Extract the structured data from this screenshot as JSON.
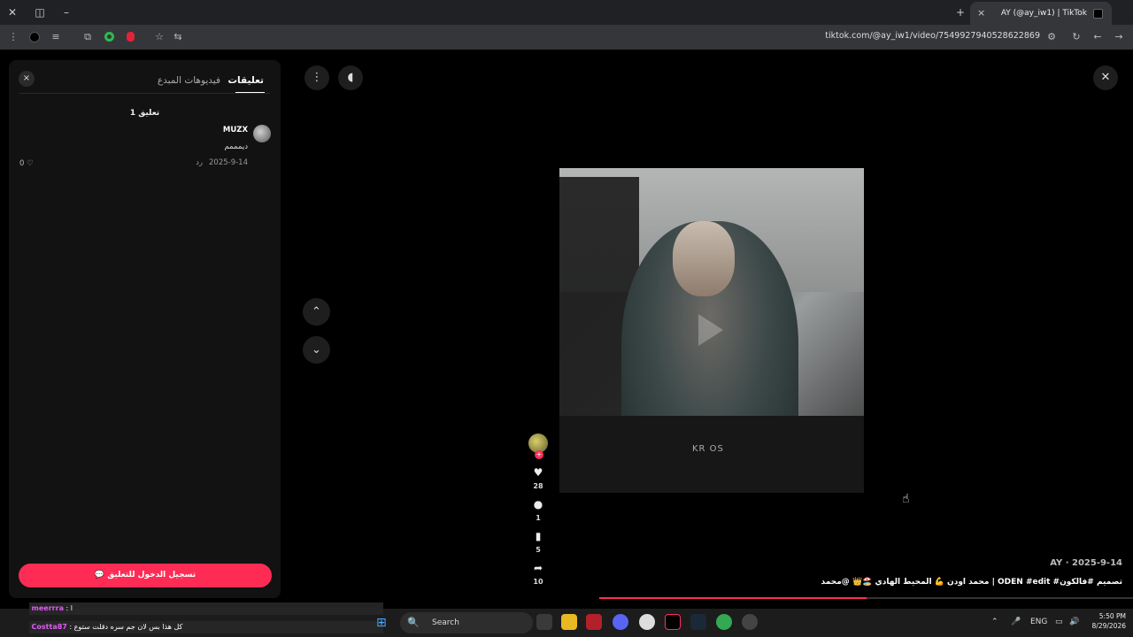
{
  "browser": {
    "tab_title": "AY (@ay_iw1) | TikTok",
    "new_tab": "+",
    "tab_close": "×",
    "url": "tiktok.com/@ay_iw1/video/7549927940528622869"
  },
  "comments_panel": {
    "close": "×",
    "tabs": [
      {
        "label": "تعليقات",
        "active": true
      },
      {
        "label": "فيديوهات المبدع",
        "active": false
      }
    ],
    "count_label": "1 تعليق",
    "comments": [
      {
        "user": "MUZX",
        "text": "ديمممم",
        "date": "2025-9-14",
        "reply_label": "رد",
        "likes": "0"
      }
    ],
    "login_button": "تسجيل الدخول للتعليق"
  },
  "video": {
    "author_line": "AY · 2025-9-14",
    "caption": "محمد اودن 💪 المحيط الهادي 🏖️👑 @محمد | ODEN #edit #تصميم #فالكون",
    "watermark": "KR  OS",
    "progress": 0.5
  },
  "actions": {
    "likes": "28",
    "comments": "1",
    "saves": "5",
    "shares": "10"
  },
  "taskbar": {
    "chat": [
      {
        "user": "meerrra",
        "text": ": ا"
      },
      {
        "user": "Costta87",
        "text": ": كل هذا بس لان جم سره دقلت ستوع"
      }
    ],
    "search_label": "Search",
    "language": "ENG",
    "time": "5:50 PM",
    "date": "8/29/2026"
  },
  "colors": {
    "accent": "#fe2c55",
    "panel_bg": "#121212",
    "page_bg": "#000000"
  }
}
